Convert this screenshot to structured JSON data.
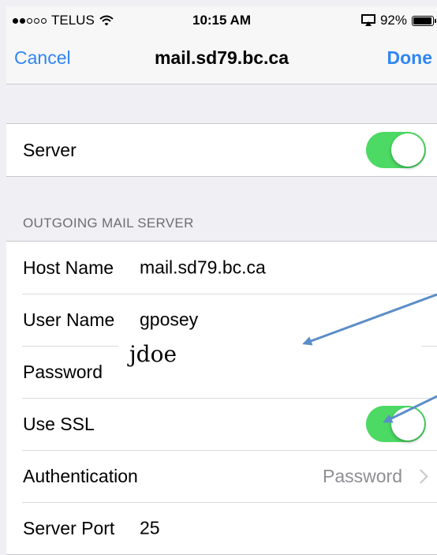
{
  "status_bar": {
    "carrier": "TELUS",
    "signal": {
      "filled": 2,
      "total": 5
    },
    "time": "10:15 AM",
    "battery": "92%",
    "icons": [
      "wifi-icon",
      "airplay-icon",
      "battery-icon"
    ]
  },
  "nav": {
    "cancel": "Cancel",
    "title": "mail.sd79.bc.ca",
    "done": "Done"
  },
  "server_group": {
    "server_label": "Server",
    "server_toggle_on": true
  },
  "outgoing": {
    "section_header": "OUTGOING MAIL SERVER",
    "host_label": "Host Name",
    "host_value": "mail.sd79.bc.ca",
    "user_label": "User Name",
    "user_value": "gposey",
    "password_label": "Password",
    "ssl_label": "Use SSL",
    "ssl_toggle_on": true,
    "auth_label": "Authentication",
    "auth_value": "Password",
    "port_label": "Server Port",
    "port_value": "25"
  },
  "annotation": {
    "overlay_text": "jdoe"
  },
  "colors": {
    "accent": "#2f86f4",
    "toggle_on": "#4cd964",
    "arrow": "#5b8ec8",
    "background": "#efeff4"
  }
}
